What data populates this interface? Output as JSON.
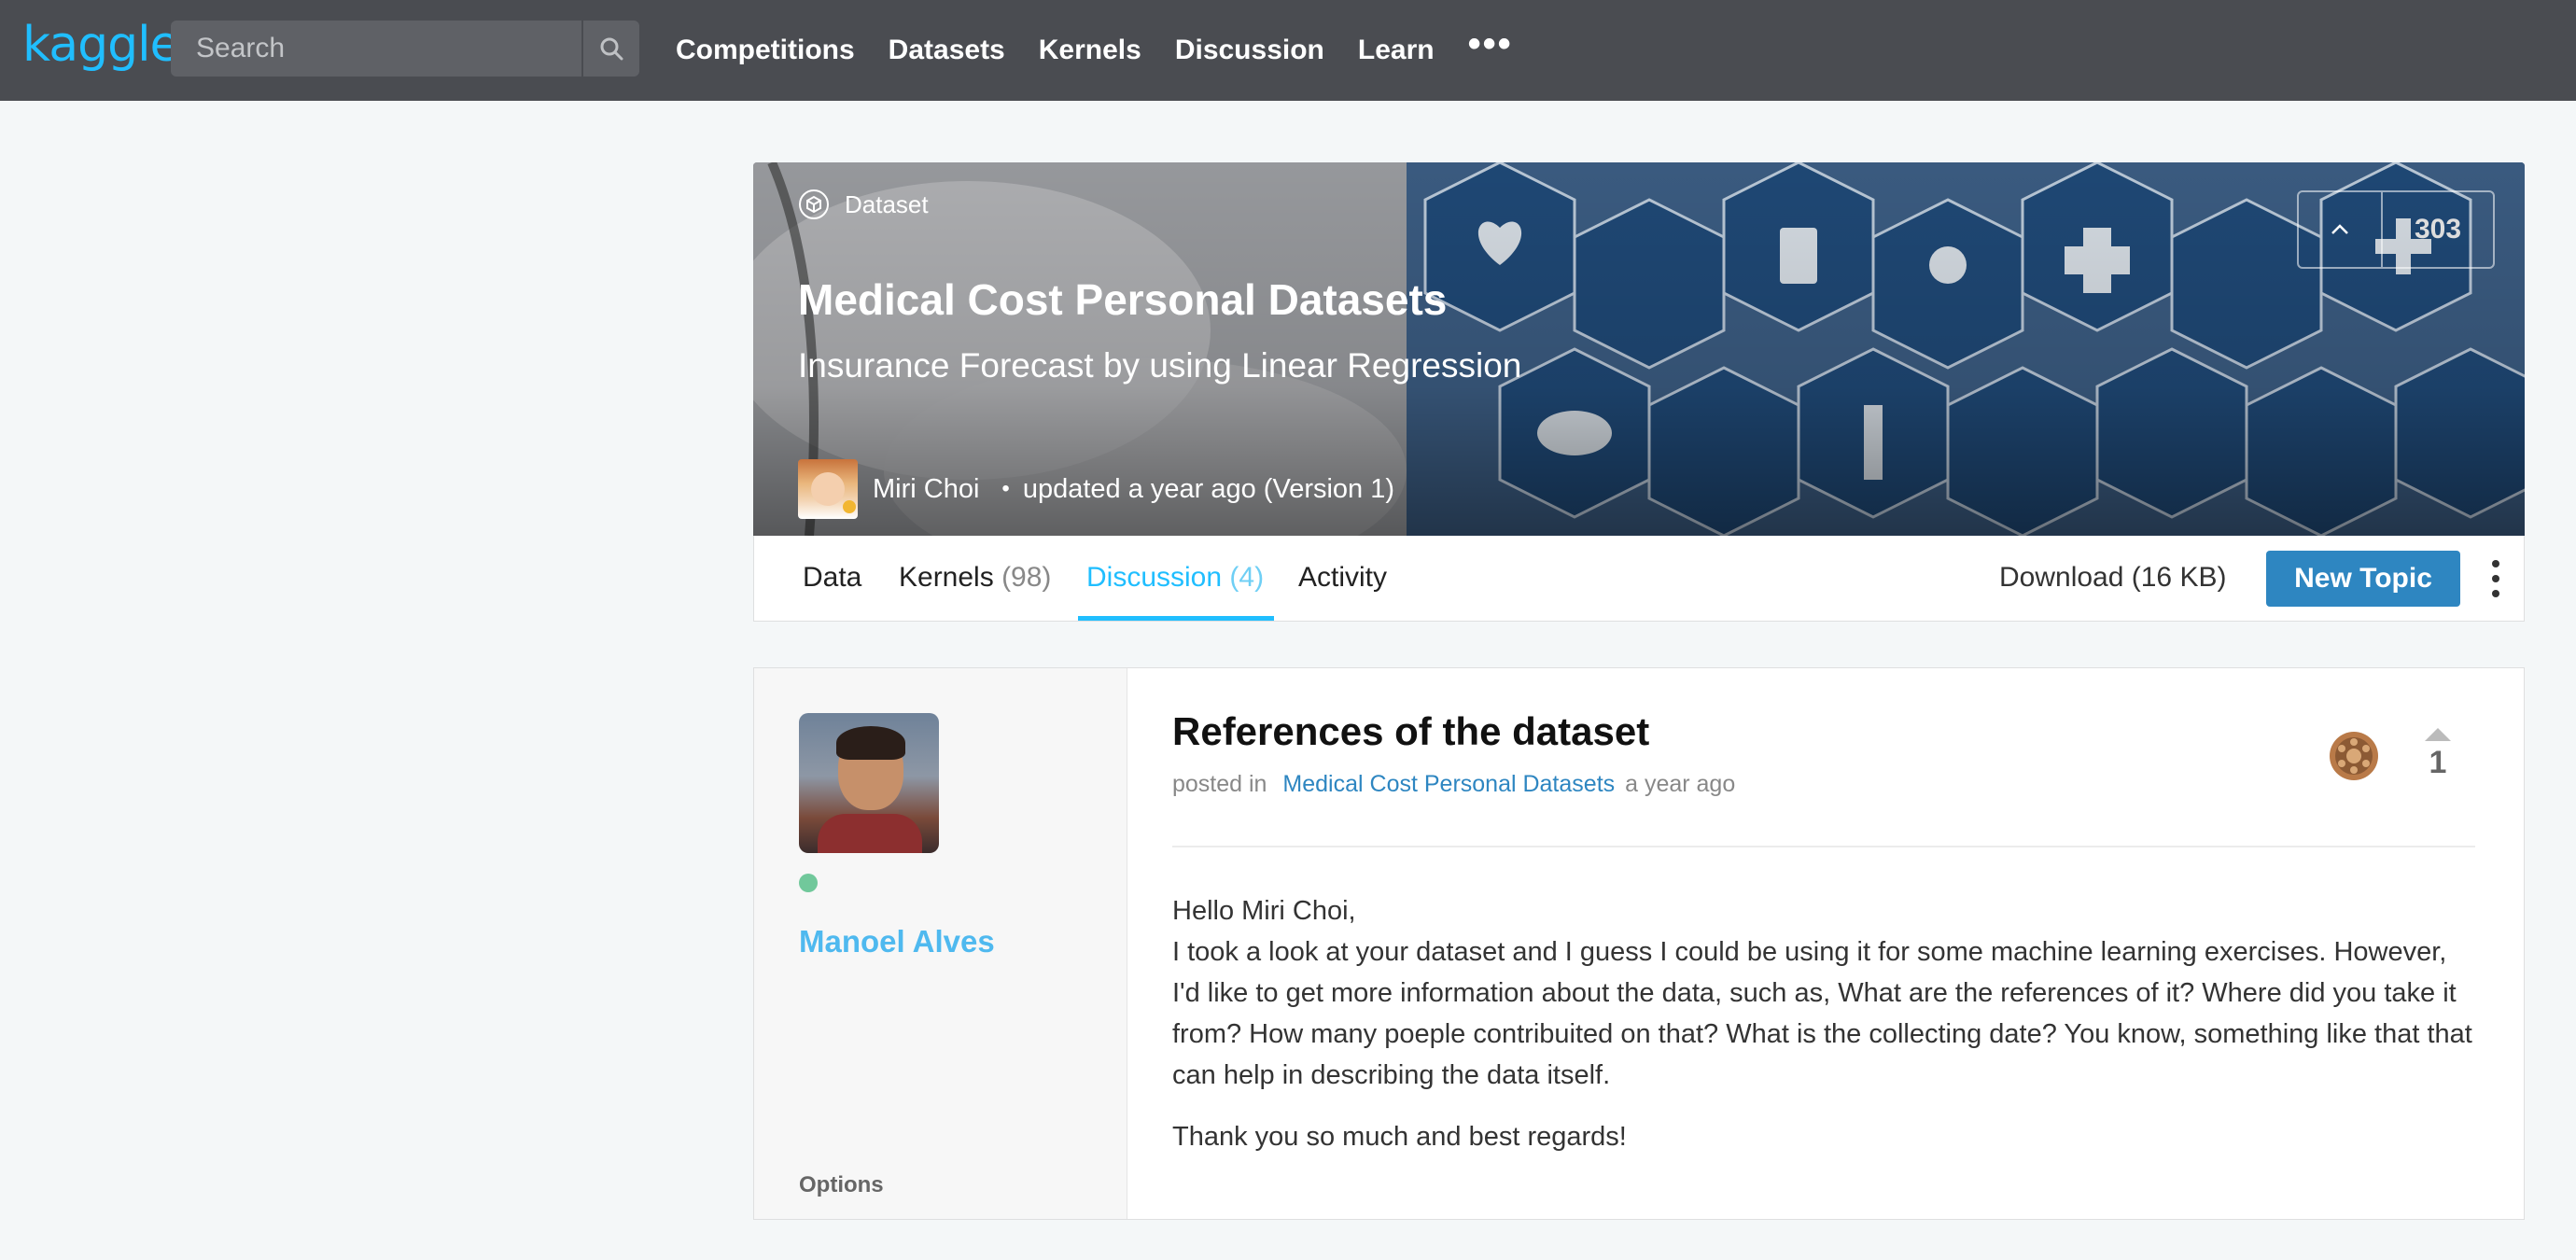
{
  "nav": {
    "logo": "kaggle",
    "search_placeholder": "Search",
    "links": [
      "Competitions",
      "Datasets",
      "Kernels",
      "Discussion",
      "Learn"
    ],
    "more": "•••"
  },
  "dataset": {
    "type_label": "Dataset",
    "title": "Medical Cost Personal Datasets",
    "subtitle": "Insurance Forecast by using Linear Regression",
    "author": "Miri Choi",
    "updated": "updated a year ago (Version 1)",
    "votes": "303"
  },
  "tabs": {
    "data": "Data",
    "kernels": "Kernels",
    "kernels_count": "(98)",
    "discussion": "Discussion",
    "discussion_count": "(4)",
    "activity": "Activity",
    "download": "Download (16 KB)",
    "new_topic": "New Topic"
  },
  "post": {
    "author": "Manoel Alves",
    "options": "Options",
    "title": "References of the dataset",
    "posted_in": "posted in",
    "dataset_link": "Medical Cost Personal Datasets",
    "posted_time": "a year ago",
    "votes": "1",
    "body": [
      "Hello Miri Choi,",
      "I took a look at your dataset and I guess I could be using it for some machine learning exercises. However, I'd like to get more information about the data, such as, What are the references of it? Where did you take it from? How many poeple contribuited on that? What is the collecting date? You know, something like that that can help in describing the data itself.",
      "Thank you so much and best regards!"
    ]
  },
  "colors": {
    "accent": "#20beff",
    "button": "#2e86c1",
    "nav_bg": "#4a4c51",
    "online": "#71c89b"
  }
}
